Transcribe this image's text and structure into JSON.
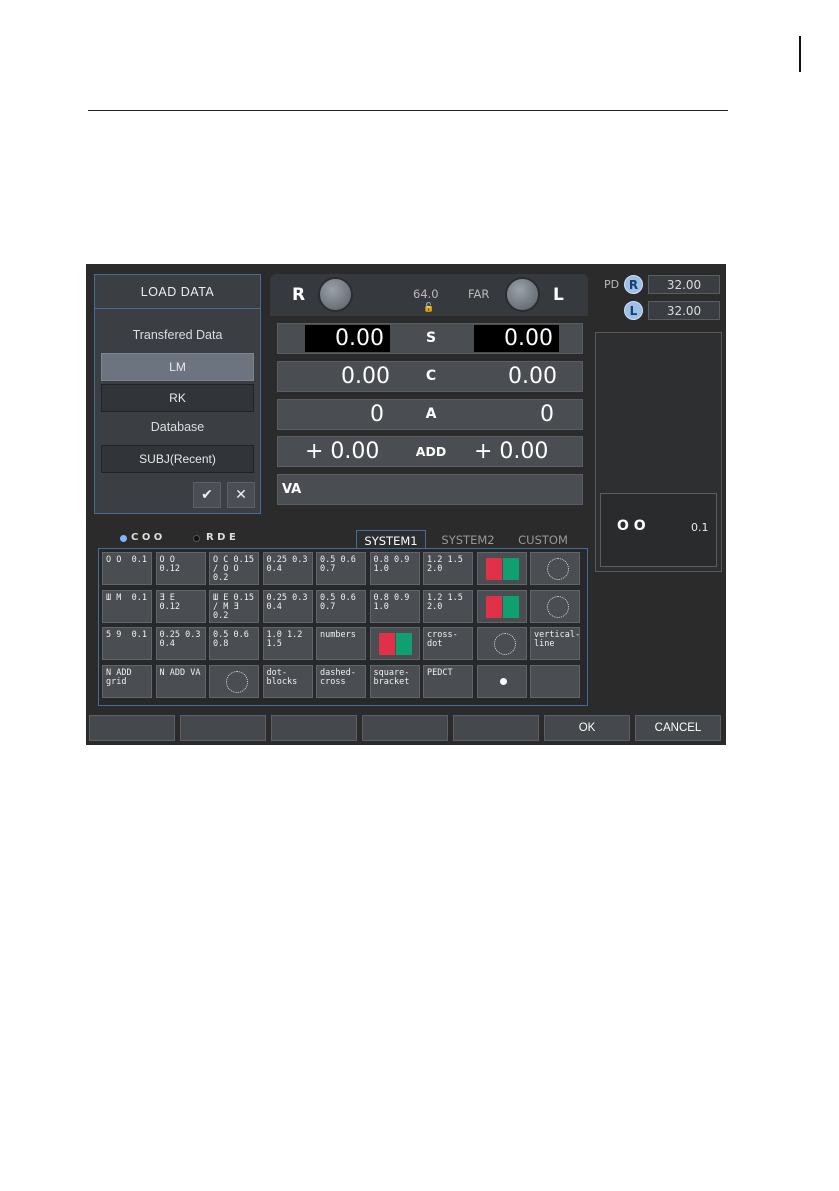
{
  "load": {
    "title": "LOAD DATA",
    "transferred_label": "Transfered Data",
    "lm": "LM",
    "rk": "RK",
    "database_label": "Database",
    "subj": "SUBJ(Recent)",
    "confirm_icon": "check-icon",
    "cancel_icon": "close-icon"
  },
  "top": {
    "right_label": "R",
    "left_label": "L",
    "pd_value": "64.0",
    "far_label": "FAR",
    "lock_icon": "lock-icon"
  },
  "rows": [
    {
      "right": "0.00",
      "label": "S",
      "left": "0.00"
    },
    {
      "right": "0.00",
      "label": "C",
      "left": "0.00"
    },
    {
      "right": "0",
      "label": "A",
      "left": "0"
    },
    {
      "right": "+ 0.00",
      "label": "ADD",
      "left": "+ 0.00"
    }
  ],
  "va": {
    "label": "VA"
  },
  "pd": {
    "label": "PD",
    "r_badge": "R",
    "l_badge": "L",
    "r_value": "32.00",
    "l_value": "32.00"
  },
  "display": {
    "value": "0.1"
  },
  "chart_mode": {
    "option1": "C O O",
    "option2": "R D E"
  },
  "tabs": [
    "SYSTEM1",
    "SYSTEM2",
    "CUSTOM"
  ],
  "grid": [
    [
      "O O  0.1",
      "O O  0.12",
      "O C 0.15 / O O 0.2",
      "0.25 0.3 0.4",
      "0.5 0.6 0.7",
      "0.8 0.9 1.0",
      "1.2 1.5 2.0",
      "red-green",
      "dots"
    ],
    [
      "Ш M  0.1",
      "Ǝ E  0.12",
      "Ш E 0.15 / M Ǝ 0.2",
      "0.25 0.3 0.4",
      "0.5 0.6 0.7",
      "0.8 0.9 1.0",
      "1.2 1.5 2.0",
      "red-green-num",
      "astig"
    ],
    [
      "5 9  0.1",
      "0.25 0.3 0.4",
      "0.5 0.6 0.8",
      "1.0 1.2 1.5",
      "numbers",
      "red-green-dots",
      "cross-dot",
      "circle-target",
      "vertical-line"
    ],
    [
      "N ADD grid",
      "N ADD VA",
      "circle-grid",
      "dot-blocks",
      "dashed-cross",
      "square-bracket",
      "PEDCT",
      "white-dot",
      ""
    ]
  ],
  "footer": {
    "ok": "OK",
    "cancel": "CANCEL"
  }
}
